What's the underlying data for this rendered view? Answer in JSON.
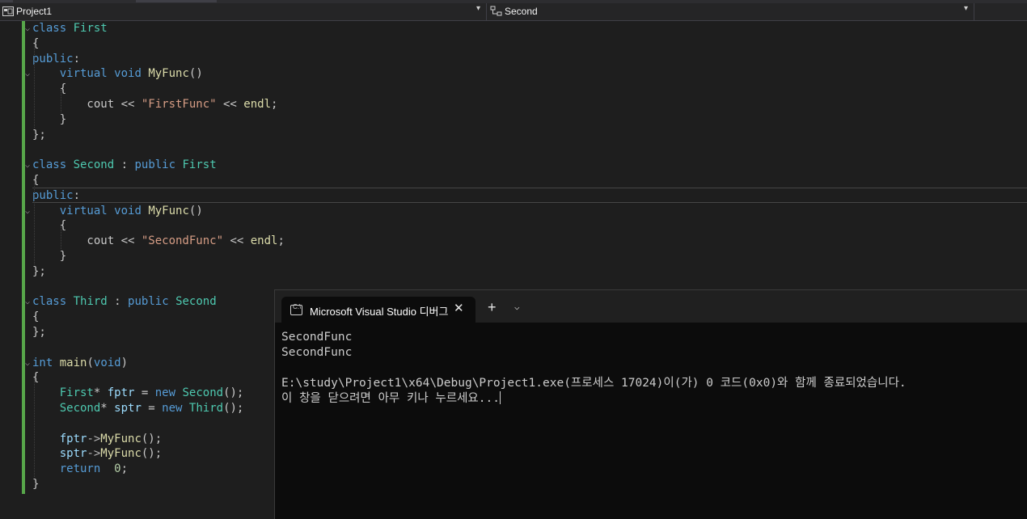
{
  "navbar": {
    "project": "Project1",
    "scope": "Second"
  },
  "code": [
    [
      [
        "k",
        "class"
      ],
      [
        "c",
        " "
      ],
      [
        "t",
        "First"
      ]
    ],
    [
      [
        "c",
        "{"
      ]
    ],
    [
      [
        "k",
        "public"
      ],
      [
        "c",
        ":"
      ]
    ],
    [
      [
        "c",
        "    "
      ],
      [
        "k",
        "virtual"
      ],
      [
        "c",
        " "
      ],
      [
        "k",
        "void"
      ],
      [
        "c",
        " "
      ],
      [
        "f",
        "MyFunc"
      ],
      [
        "c",
        "()"
      ]
    ],
    [
      [
        "c",
        "    {"
      ]
    ],
    [
      [
        "c",
        "        cout << "
      ],
      [
        "s",
        "\"FirstFunc\""
      ],
      [
        "c",
        " << "
      ],
      [
        "f",
        "endl"
      ],
      [
        "c",
        ";"
      ]
    ],
    [
      [
        "c",
        "    }"
      ]
    ],
    [
      [
        "c",
        "};"
      ]
    ],
    [],
    [
      [
        "k",
        "class"
      ],
      [
        "c",
        " "
      ],
      [
        "t",
        "Second"
      ],
      [
        "c",
        " : "
      ],
      [
        "k",
        "public"
      ],
      [
        "c",
        " "
      ],
      [
        "t",
        "First"
      ]
    ],
    [
      [
        "c",
        "{"
      ]
    ],
    [
      [
        "k",
        "public"
      ],
      [
        "c",
        ":"
      ]
    ],
    [
      [
        "c",
        "    "
      ],
      [
        "k",
        "virtual"
      ],
      [
        "c",
        " "
      ],
      [
        "k",
        "void"
      ],
      [
        "c",
        " "
      ],
      [
        "f",
        "MyFunc"
      ],
      [
        "c",
        "()"
      ]
    ],
    [
      [
        "c",
        "    {"
      ]
    ],
    [
      [
        "c",
        "        cout << "
      ],
      [
        "s",
        "\"SecondFunc\""
      ],
      [
        "c",
        " << "
      ],
      [
        "f",
        "endl"
      ],
      [
        "c",
        ";"
      ]
    ],
    [
      [
        "c",
        "    }"
      ]
    ],
    [
      [
        "c",
        "};"
      ]
    ],
    [],
    [
      [
        "k",
        "class"
      ],
      [
        "c",
        " "
      ],
      [
        "t",
        "Third"
      ],
      [
        "c",
        " : "
      ],
      [
        "k",
        "public"
      ],
      [
        "c",
        " "
      ],
      [
        "t",
        "Second"
      ]
    ],
    [
      [
        "c",
        "{"
      ]
    ],
    [
      [
        "c",
        "};"
      ]
    ],
    [],
    [
      [
        "k",
        "int"
      ],
      [
        "c",
        " "
      ],
      [
        "f",
        "main"
      ],
      [
        "c",
        "("
      ],
      [
        "k",
        "void"
      ],
      [
        "c",
        ")"
      ]
    ],
    [
      [
        "c",
        "{"
      ]
    ],
    [
      [
        "c",
        "    "
      ],
      [
        "t",
        "First"
      ],
      [
        "c",
        "* "
      ],
      [
        "v",
        "fptr"
      ],
      [
        "c",
        " = "
      ],
      [
        "k",
        "new"
      ],
      [
        "c",
        " "
      ],
      [
        "t",
        "Second"
      ],
      [
        "c",
        "();"
      ]
    ],
    [
      [
        "c",
        "    "
      ],
      [
        "t",
        "Second"
      ],
      [
        "c",
        "* "
      ],
      [
        "v",
        "sptr"
      ],
      [
        "c",
        " = "
      ],
      [
        "k",
        "new"
      ],
      [
        "c",
        " "
      ],
      [
        "t",
        "Third"
      ],
      [
        "c",
        "();"
      ]
    ],
    [],
    [
      [
        "c",
        "    "
      ],
      [
        "v",
        "fptr"
      ],
      [
        "p",
        "->"
      ],
      [
        "f",
        "MyFunc"
      ],
      [
        "c",
        "();"
      ]
    ],
    [
      [
        "c",
        "    "
      ],
      [
        "v",
        "sptr"
      ],
      [
        "p",
        "->"
      ],
      [
        "f",
        "MyFunc"
      ],
      [
        "c",
        "();"
      ]
    ],
    [
      [
        "c",
        "    "
      ],
      [
        "k",
        "return"
      ],
      [
        "c",
        "  "
      ],
      [
        "n",
        "0"
      ],
      [
        "c",
        ";"
      ]
    ],
    [
      [
        "c",
        "}"
      ]
    ]
  ],
  "console": {
    "tab_title": "Microsoft Visual Studio 디버그",
    "close_glyph": "✕",
    "new_tab_glyph": "+",
    "dropdown_glyph": "⌵",
    "lines": [
      "SecondFunc",
      "SecondFunc",
      "",
      "E:\\study\\Project1\\x64\\Debug\\Project1.exe(프로세스 17024)이(가) 0 코드(0x0)와 함께 종료되었습니다.",
      "이 창을 닫으려면 아무 키나 누르세요..."
    ]
  },
  "icons": [
    "project-icon",
    "class-scope-icon",
    "dropdown-caret-icon",
    "fold-chevron-icon",
    "console-app-icon",
    "close-icon",
    "plus-icon",
    "chevron-down-icon"
  ]
}
